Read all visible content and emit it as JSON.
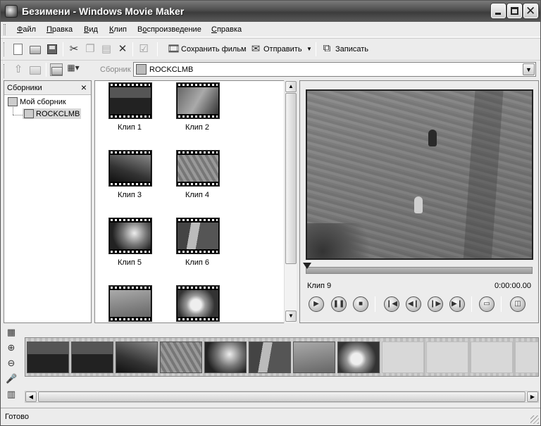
{
  "window": {
    "title": "Безимени - Windows Movie Maker"
  },
  "menu": [
    {
      "label": "Файл",
      "hot": "Ф"
    },
    {
      "label": "Правка",
      "hot": "П"
    },
    {
      "label": "Вид",
      "hot": "В"
    },
    {
      "label": "Клип",
      "hot": "К"
    },
    {
      "label": "Воспроизведение",
      "hot": "о"
    },
    {
      "label": "Справка",
      "hot": "С"
    }
  ],
  "toolbar": {
    "save_movie": "Сохранить фильм",
    "send": "Отправить",
    "record": "Записать"
  },
  "collection_bar": {
    "label": "Сборник",
    "value": "ROCKCLMB"
  },
  "collections_pane": {
    "title": "Сборники",
    "close": "×",
    "root": "Мой сборник",
    "child": "ROCKCLMB"
  },
  "clips": [
    {
      "label": "Клип 1"
    },
    {
      "label": "Клип 2"
    },
    {
      "label": "Клип 3"
    },
    {
      "label": "Клип 4"
    },
    {
      "label": "Клип 5"
    },
    {
      "label": "Клип 6"
    },
    {
      "label": ""
    },
    {
      "label": ""
    }
  ],
  "monitor": {
    "clip": "Клип 9",
    "time": "0:00:00.00"
  },
  "storyboard": {
    "filled_frames": 8,
    "empty_frames": 4
  },
  "status": {
    "text": "Готово"
  }
}
